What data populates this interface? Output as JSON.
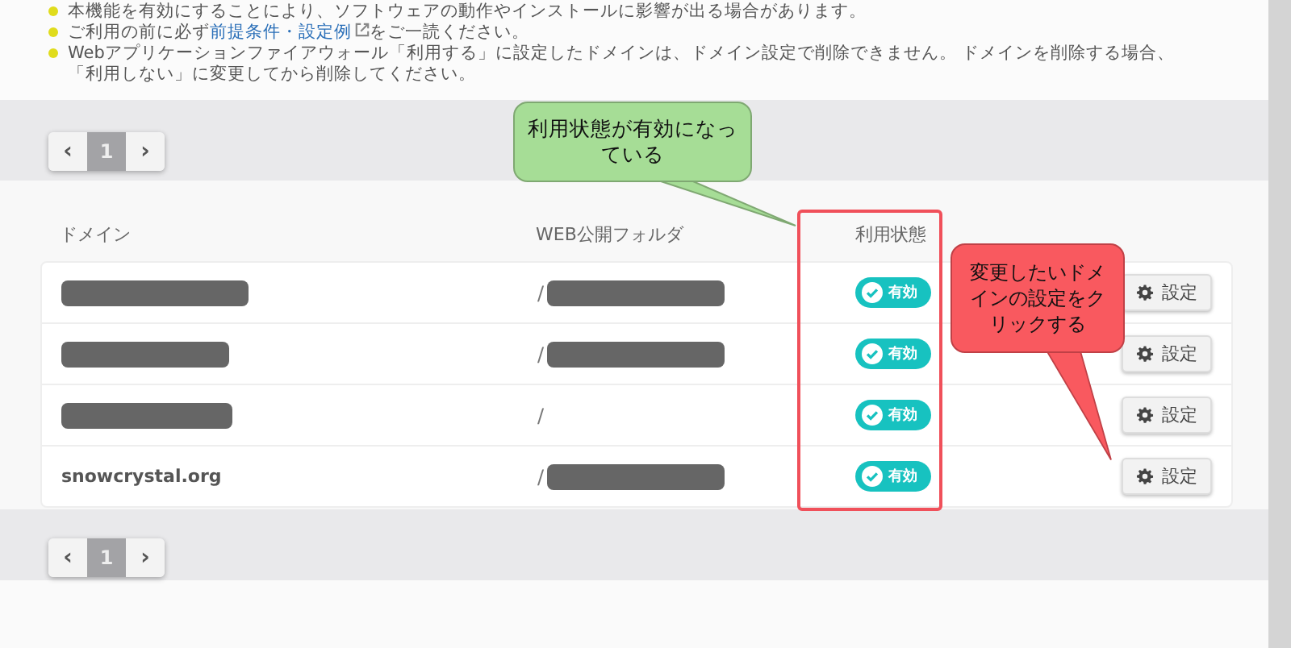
{
  "notes": [
    {
      "text": "本機能を有効にすることにより、ソフトウェアの動作やインストールに影響が出る場合があります。"
    },
    {
      "text": "ご利用の前に必ず",
      "link": "前提条件・設定例",
      "after": "をご一読ください。"
    },
    {
      "text": "Webアプリケーションファイアウォール「利用する」に設定したドメインは、ドメイン設定で削除できません。 ドメインを削除する場合、「利用しない」に変更してから削除してください。"
    }
  ],
  "pagination_top": {
    "prev": "‹",
    "pages": [
      {
        "label": "1",
        "selected": true
      }
    ],
    "next": "›"
  },
  "table": {
    "columns": [
      "ドメイン",
      "WEB公開フォルダ",
      "利用状態"
    ],
    "rows": [
      {
        "domain_redacted": true,
        "folder": "/",
        "folder_redacted": true,
        "status": "有効",
        "enabled": true,
        "button": "設定"
      },
      {
        "domain_redacted": true,
        "folder": "/",
        "folder_redacted": true,
        "status": "有効",
        "enabled": true,
        "button": "設定"
      },
      {
        "domain_redacted": true,
        "folder": "/",
        "folder_redacted": false,
        "status": "有効",
        "enabled": true,
        "button": "設定"
      },
      {
        "domain": "snowcrystal.org",
        "domain_redacted": false,
        "folder": "/",
        "folder_redacted": true,
        "status": "有効",
        "enabled": true,
        "button": "設定"
      }
    ]
  },
  "pagination_bottom": {
    "prev": "‹",
    "pages": [
      {
        "label": "1",
        "selected": true
      }
    ],
    "next": "›"
  },
  "callouts": [
    {
      "kind": "green",
      "text": "利用状態が有効になっている"
    },
    {
      "kind": "red",
      "text": "変更したいドメインの設定をクリックする"
    }
  ]
}
